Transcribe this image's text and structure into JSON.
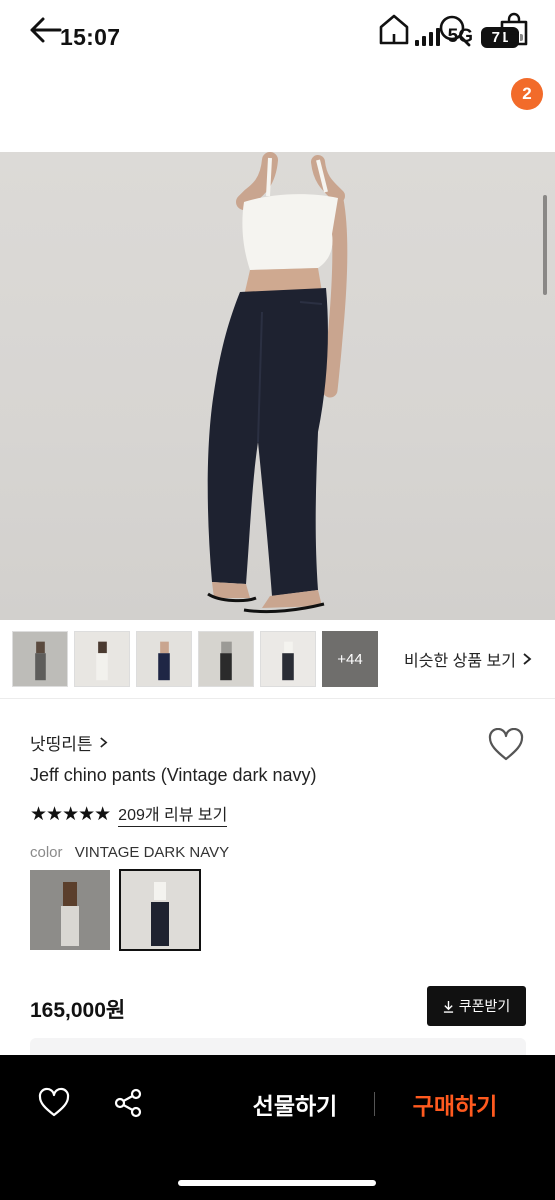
{
  "status_bar": {
    "time": "15:07",
    "network": "5G",
    "battery": "71"
  },
  "header": {
    "icons": [
      "back-arrow-icon",
      "home-icon",
      "search-icon",
      "shopping-bag-icon"
    ],
    "cart_count": "2"
  },
  "gallery": {
    "more_count": "+44",
    "similar_label": "비슷한 상품 보기"
  },
  "product": {
    "brand": "낫띵리튼",
    "title": "Jeff chino pants (Vintage dark navy)",
    "stars": "★★★★★",
    "review_link": "209개 리뷰 보기",
    "color_label": "color",
    "color_value": "VINTAGE DARK NAVY",
    "price": "165,000원",
    "coupon_label": "쿠폰받기"
  },
  "bottom_bar": {
    "gift_label": "선물하기",
    "buy_label": "구매하기"
  },
  "colors": {
    "accent": "#ff5a1f",
    "badge": "#f26b2a",
    "bar_bg": "#000000"
  }
}
